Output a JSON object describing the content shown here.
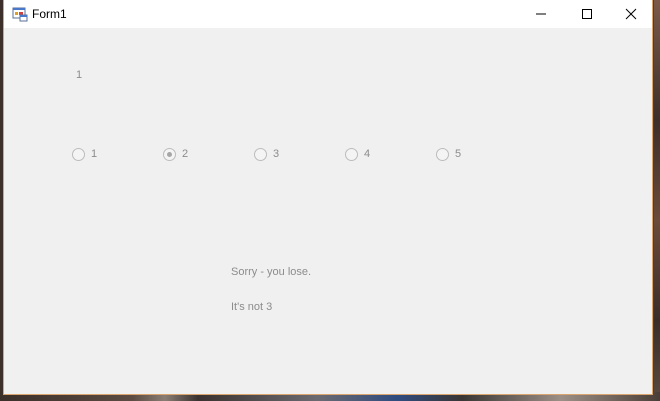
{
  "window": {
    "title": "Form1"
  },
  "form": {
    "top_label": "1",
    "radios": [
      {
        "label": "1",
        "checked": false
      },
      {
        "label": "2",
        "checked": true
      },
      {
        "label": "3",
        "checked": false
      },
      {
        "label": "4",
        "checked": false
      },
      {
        "label": "5",
        "checked": false
      }
    ],
    "result_message": "Sorry - you lose.",
    "hint_message": "It's not 3"
  },
  "colors": {
    "titlebar": "#ffffff",
    "client_background": "#f0f0f0",
    "window_border": "#d9a46e",
    "disabled_text": "#8c8c8c"
  },
  "icons": {
    "app": "windows-form-icon",
    "minimize": "minimize-icon",
    "maximize": "maximize-icon",
    "close": "close-icon"
  }
}
